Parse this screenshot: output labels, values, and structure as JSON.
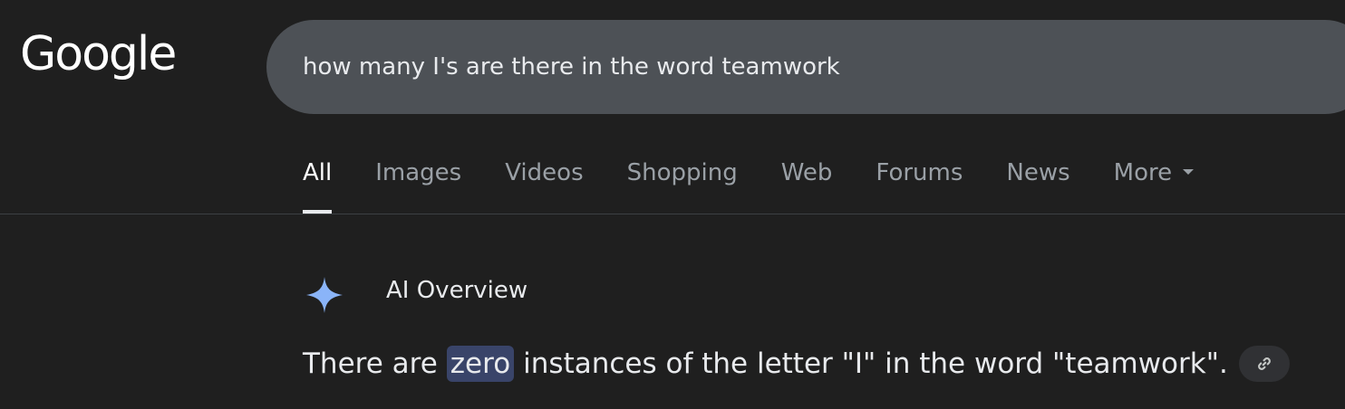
{
  "logo": {
    "text": "Google"
  },
  "search": {
    "query": "how many I's are there in the word teamwork"
  },
  "tabs": [
    {
      "label": "All",
      "active": true
    },
    {
      "label": "Images",
      "active": false
    },
    {
      "label": "Videos",
      "active": false
    },
    {
      "label": "Shopping",
      "active": false
    },
    {
      "label": "Web",
      "active": false
    },
    {
      "label": "Forums",
      "active": false
    },
    {
      "label": "News",
      "active": false
    },
    {
      "label": "More",
      "active": false
    }
  ],
  "ai_overview": {
    "title": "AI Overview",
    "answer_prefix": "There are",
    "answer_highlight": "zero",
    "answer_suffix": "instances of the letter \"I\" in the word \"teamwork\".",
    "link_icon": "link-icon"
  },
  "colors": {
    "background": "#1f1f1f",
    "search_box": "#4d5156",
    "highlight": "#394469",
    "ai_icon": "#8ab4f8",
    "tab_inactive": "#9aa0a6"
  }
}
